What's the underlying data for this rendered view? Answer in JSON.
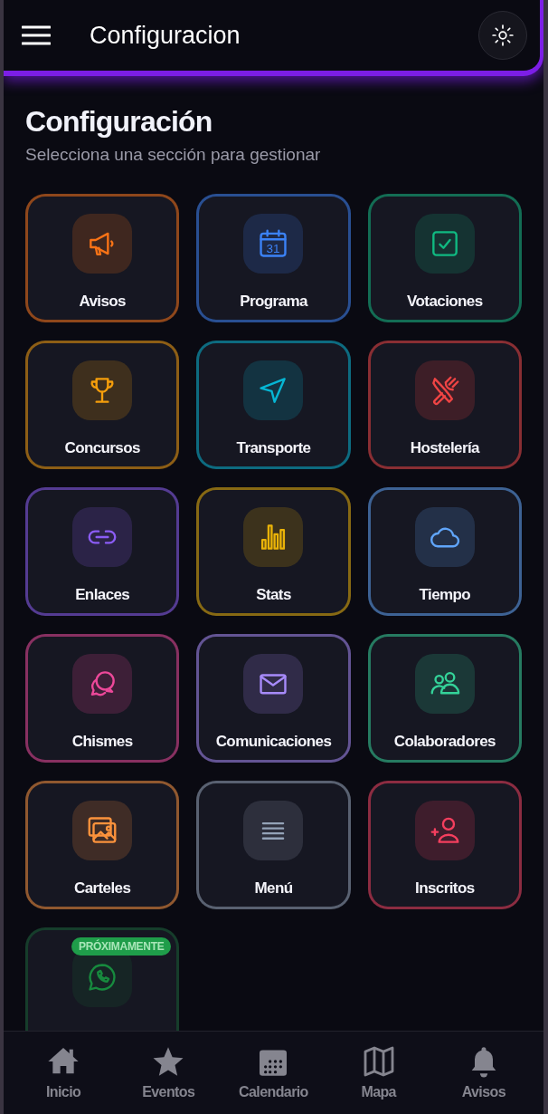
{
  "header": {
    "title": "Configuracion"
  },
  "page": {
    "title": "Configuración",
    "subtitle": "Selecciona una sección para gestionar"
  },
  "sections": [
    {
      "label": "Avisos",
      "color": "#f97316",
      "disabled": false
    },
    {
      "label": "Programa",
      "color": "#3b82f6",
      "icon_text": "31",
      "disabled": false
    },
    {
      "label": "Votaciones",
      "color": "#10b981",
      "disabled": false
    },
    {
      "label": "Concursos",
      "color": "#f59e0b",
      "disabled": false
    },
    {
      "label": "Transporte",
      "color": "#06b6d4",
      "disabled": false
    },
    {
      "label": "Hostelería",
      "color": "#ef4444",
      "disabled": false
    },
    {
      "label": "Enlaces",
      "color": "#8b5cf6",
      "disabled": false
    },
    {
      "label": "Stats",
      "color": "#eab308",
      "disabled": false
    },
    {
      "label": "Tiempo",
      "color": "#60a5fa",
      "disabled": false
    },
    {
      "label": "Chismes",
      "color": "#ec4899",
      "disabled": false
    },
    {
      "label": "Comunicaciones",
      "color": "#a78bfa",
      "disabled": false
    },
    {
      "label": "Colaboradores",
      "color": "#34d399",
      "disabled": false
    },
    {
      "label": "Carteles",
      "color": "#fb923c",
      "disabled": false
    },
    {
      "label": "Menú",
      "color": "#94a3b8",
      "disabled": false
    },
    {
      "label": "Inscritos",
      "color": "#f43f5e",
      "disabled": false
    },
    {
      "color": "#178a3e",
      "badge": "PRÓXIMAMENTE",
      "disabled": true
    }
  ],
  "bottom_nav": [
    {
      "label": "Inicio",
      "selected": false
    },
    {
      "label": "Eventos",
      "selected": false
    },
    {
      "label": "Calendario",
      "selected": false
    },
    {
      "label": "Mapa",
      "selected": false
    },
    {
      "label": "Avisos",
      "selected": false
    }
  ]
}
